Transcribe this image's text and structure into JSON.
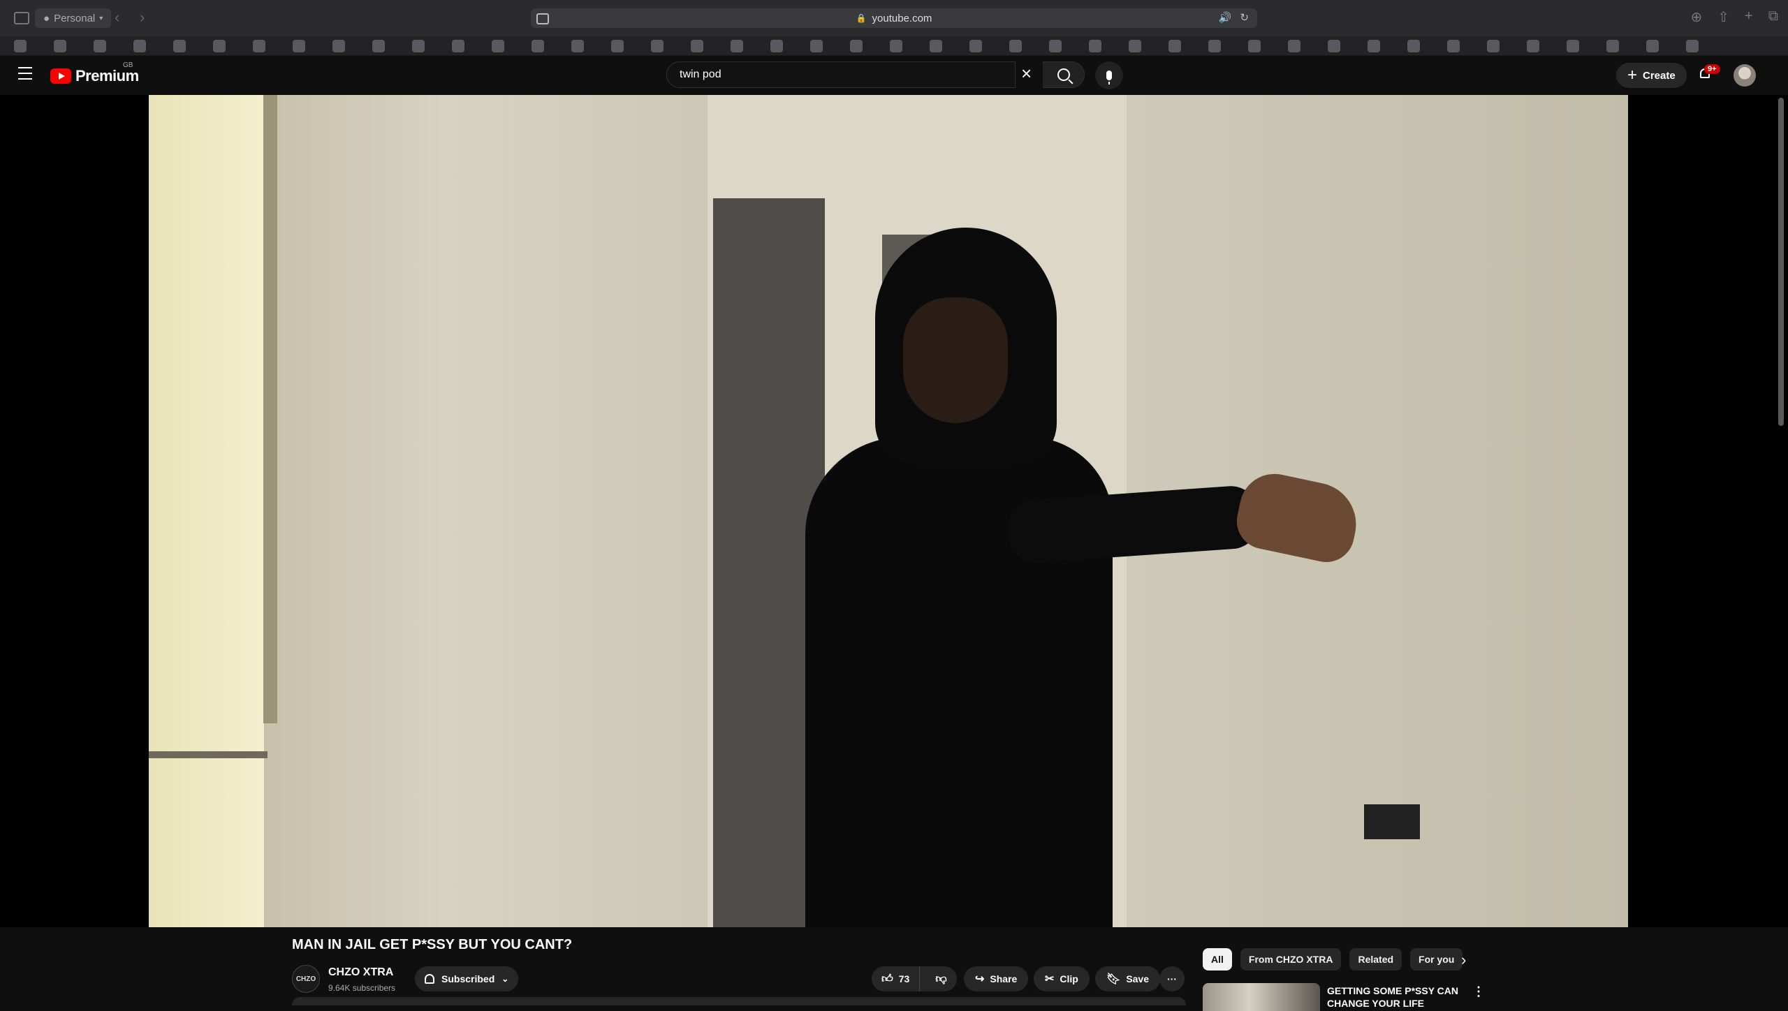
{
  "browser": {
    "profile_label": "Personal",
    "url": "youtube.com"
  },
  "youtube": {
    "logo_text": "Premium",
    "country_code": "GB",
    "search": {
      "value": "twin pod"
    },
    "create_label": "Create",
    "notification_badge": "9+"
  },
  "video": {
    "title": "MAN IN JAIL GET P*SSY BUT YOU CANT?",
    "channel": {
      "name": "CHZO XTRA",
      "subscribers": "9.64K subscribers",
      "avatar_text": "CHZO"
    },
    "subscribed_label": "Subscribed",
    "likes": "73",
    "share_label": "Share",
    "clip_label": "Clip",
    "save_label": "Save"
  },
  "sidebar_chips": [
    "All",
    "From CHZO XTRA",
    "Related",
    "For you"
  ],
  "recommendation": {
    "title": "GETTING SOME P*SSY CAN CHANGE YOUR LIFE"
  },
  "icons": {
    "menu": "hamburger-icon",
    "search": "search-icon",
    "mic": "mic-icon",
    "bell": "bell-icon",
    "like": "thumbs-up-icon",
    "dislike": "thumbs-down-icon",
    "share": "share-icon",
    "clip": "scissors-icon",
    "save": "bookmark-icon",
    "more": "more-horizontal-icon"
  },
  "colors": {
    "brand_red": "#ff0000",
    "background": "#0f0f0f",
    "pill_bg": "#272727",
    "badge_red": "#cc0000"
  }
}
